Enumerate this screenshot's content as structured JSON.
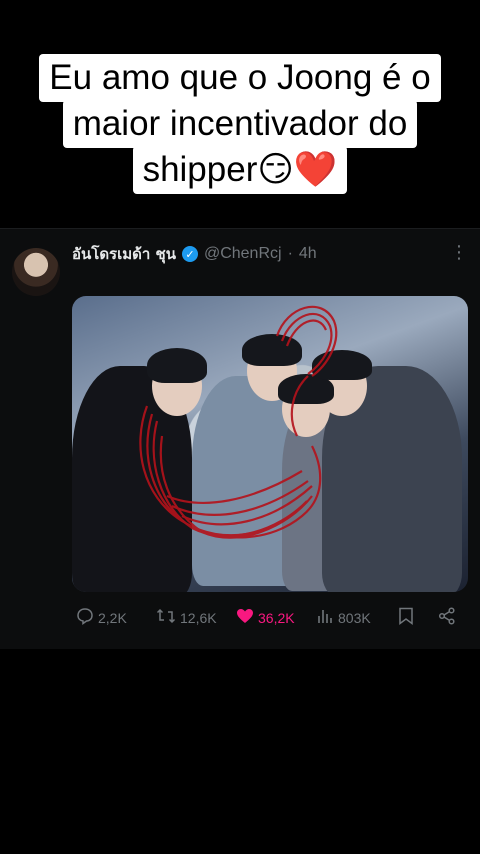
{
  "overlay": {
    "caption_lines": [
      "Eu amo que o Joong é o",
      "maior incentivador do",
      "shipper"
    ],
    "caption_emojis": "😏❤️"
  },
  "tweet": {
    "author_name": "อันโดรเมด้า ชุน",
    "handle": "@ChenRcj",
    "separator": "·",
    "time": "4h",
    "verified_glyph": "✓",
    "more_glyph": "⋮",
    "stats": {
      "replies": "2,2K",
      "retweets": "12,6K",
      "likes": "36,2K",
      "views": "803K"
    }
  },
  "icons": {
    "reply": "reply-icon",
    "retweet": "retweet-icon",
    "like": "heart-icon",
    "views": "views-icon",
    "bookmark": "bookmark-icon",
    "share": "share-icon"
  },
  "colors": {
    "like_accent": "#f91880",
    "verified_blue": "#1d9bf0",
    "muted_text": "#71767b",
    "scribble_red": "#b4121b"
  }
}
